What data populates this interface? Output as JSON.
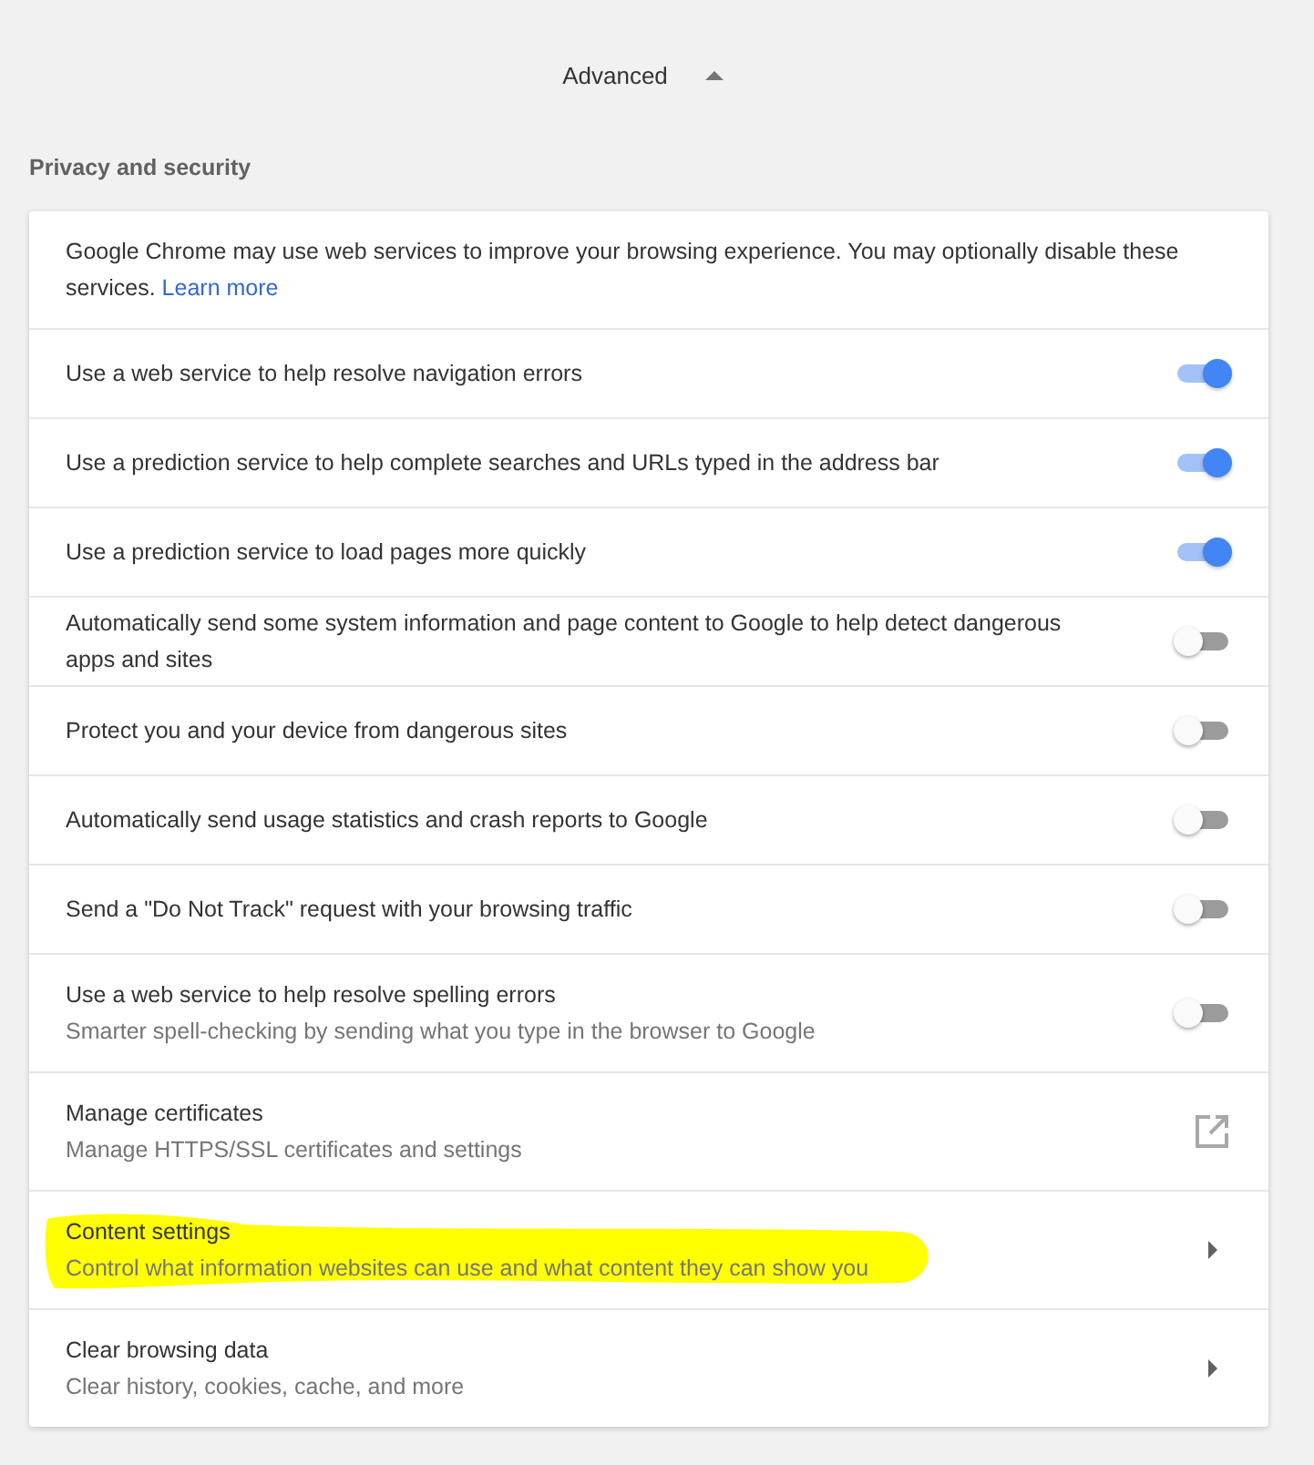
{
  "header": {
    "label": "Advanced",
    "expanded": true
  },
  "section": {
    "title": "Privacy and security"
  },
  "intro": {
    "text": "Google Chrome may use web services to improve your browsing experience. You may optionally disable these services.",
    "link": "Learn more"
  },
  "rows": [
    {
      "kind": "toggle",
      "label": "Use a web service to help resolve navigation errors",
      "on": true,
      "highlighted": false
    },
    {
      "kind": "toggle",
      "label": "Use a prediction service to help complete searches and URLs typed in the address bar",
      "on": true,
      "highlighted": false
    },
    {
      "kind": "toggle",
      "label": "Use a prediction service to load pages more quickly",
      "on": true,
      "highlighted": false
    },
    {
      "kind": "toggle",
      "label": "Automatically send some system information and page content to Google to help detect dangerous apps and sites",
      "on": false,
      "highlighted": false
    },
    {
      "kind": "toggle",
      "label": "Protect you and your device from dangerous sites",
      "on": false,
      "highlighted": false
    },
    {
      "kind": "toggle",
      "label": "Automatically send usage statistics and crash reports to Google",
      "on": false,
      "highlighted": false
    },
    {
      "kind": "toggle",
      "label": "Send a \"Do Not Track\" request with your browsing traffic",
      "on": false,
      "highlighted": false
    },
    {
      "kind": "toggle",
      "label": "Use a web service to help resolve spelling errors",
      "sublabel": "Smarter spell-checking by sending what you type in the browser to Google",
      "on": false,
      "highlighted": false
    },
    {
      "kind": "external",
      "label": "Manage certificates",
      "sublabel": "Manage HTTPS/SSL certificates and settings",
      "highlighted": false
    },
    {
      "kind": "submenu",
      "label": "Content settings",
      "sublabel": "Control what information websites can use and what content they can show you",
      "highlighted": true
    },
    {
      "kind": "submenu",
      "label": "Clear browsing data",
      "sublabel": "Clear history, cookies, cache, and more",
      "highlighted": false
    }
  ]
}
